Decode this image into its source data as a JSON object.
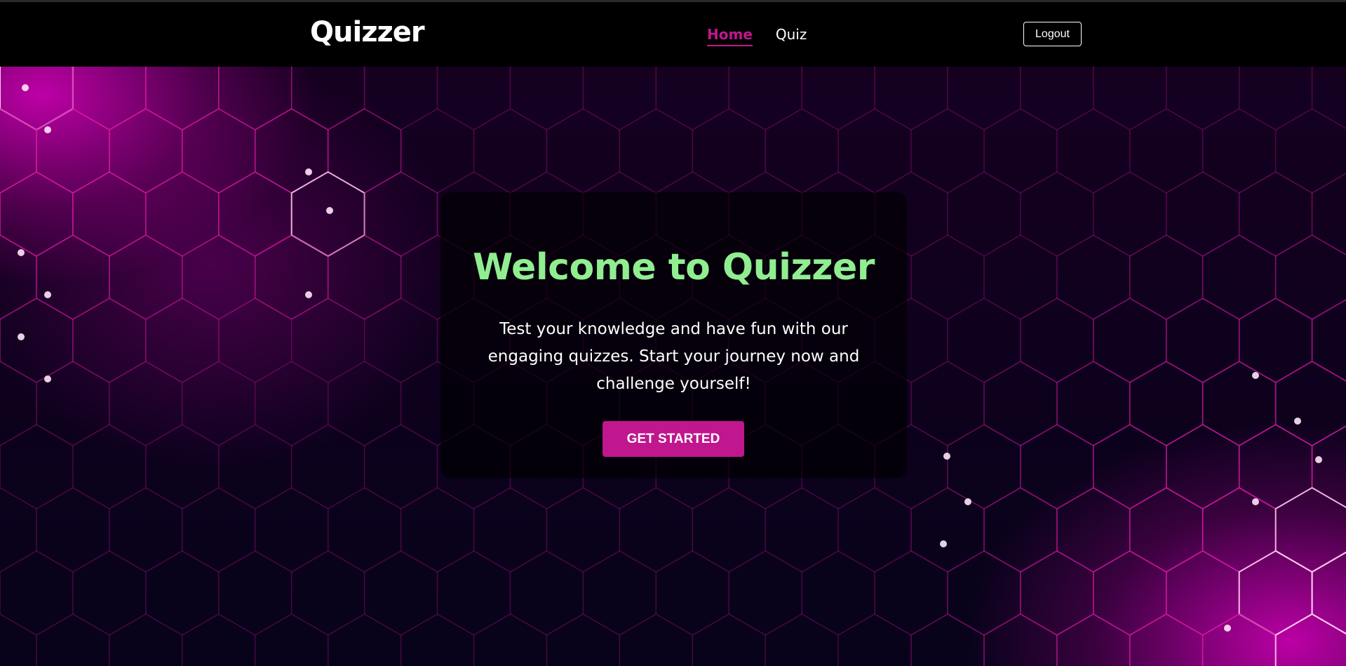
{
  "header": {
    "brand": "Quizzer",
    "nav": [
      {
        "label": "Home",
        "active": true
      },
      {
        "label": "Quiz",
        "active": false
      }
    ],
    "logout_label": "Logout"
  },
  "hero": {
    "title": "Welcome to Quizzer",
    "text": "Test your knowledge and have fun with our engaging quizzes. Start your journey now and challenge yourself!",
    "cta_label": "GET STARTED"
  },
  "colors": {
    "accent": "#c0168e",
    "title": "#90ee90",
    "background": "#05010f"
  }
}
